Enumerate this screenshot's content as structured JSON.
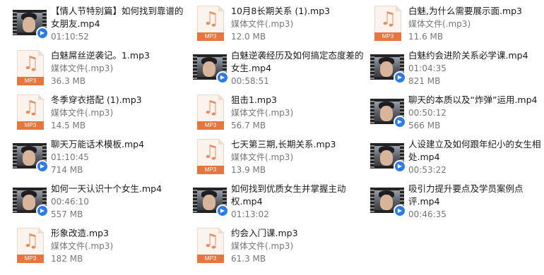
{
  "files": [
    {
      "name": "【情人节特别篇】如何找到靠谱的女朋友.mp4",
      "type_label": "",
      "detail": "01:10:52",
      "kind": "video"
    },
    {
      "name": "10月8长期关系 (1).mp3",
      "type_label": "媒体文件(.mp3)",
      "detail": "12.0 MB",
      "kind": "audio"
    },
    {
      "name": "白魅,为什么需要展示面.mp3",
      "type_label": "媒体文件(.mp3)",
      "detail": "11.6 MB",
      "kind": "audio"
    },
    {
      "name": "白魅屌丝逆袭记。1.mp3",
      "type_label": "媒体文件(.mp3)",
      "detail": "36.3 MB",
      "kind": "audio"
    },
    {
      "name": "白魅逆袭经历及如何搞定态度差的女生.mp4",
      "type_label": "",
      "detail": "00:58:51",
      "kind": "video"
    },
    {
      "name": "白魅约会进阶关系必学课.mp4",
      "type_label": "01:04:35",
      "detail": "821 MB",
      "kind": "video"
    },
    {
      "name": "冬季穿衣搭配 (1).mp3",
      "type_label": "媒体文件(.mp3)",
      "detail": "14.5 MB",
      "kind": "audio"
    },
    {
      "name": "狙击1.mp3",
      "type_label": "媒体文件(.mp3)",
      "detail": "56.7 MB",
      "kind": "audio"
    },
    {
      "name": "聊天的本质以及“炸弹”运用.mp4",
      "type_label": "00:50:12",
      "detail": "566 MB",
      "kind": "video"
    },
    {
      "name": "聊天万能话术模板.mp4",
      "type_label": "01:10:45",
      "detail": "714 MB",
      "kind": "video"
    },
    {
      "name": "七天第三期,长期关系.mp3",
      "type_label": "媒体文件(.mp3)",
      "detail": "13.9 MB",
      "kind": "audio"
    },
    {
      "name": "人设建立及如何跟年纪小的女生相处.mp4",
      "type_label": "",
      "detail": "00:53:22",
      "kind": "video"
    },
    {
      "name": "如何一天认识十个女生.mp4",
      "type_label": "00:46:10",
      "detail": "557 MB",
      "kind": "video"
    },
    {
      "name": "如何找到优质女生并掌握主动权.mp4",
      "type_label": "",
      "detail": "01:13:02",
      "kind": "video"
    },
    {
      "name": "吸引力提升要点及学员案例点评.mp4",
      "type_label": "",
      "detail": "00:46:35",
      "kind": "video"
    },
    {
      "name": "形象改造.mp3",
      "type_label": "媒体文件(.mp3)",
      "detail": "182 MB",
      "kind": "audio"
    },
    {
      "name": "约会入门课.mp3",
      "type_label": "媒体文件(.mp3)",
      "detail": "61.3 MB",
      "kind": "audio"
    }
  ],
  "icons": {
    "audio_icon": "mp3-file-icon",
    "audio_bar_label": "MP3",
    "video_icon": "video-thumbnail-icon"
  },
  "colors": {
    "mp3_bar": "#e7753e",
    "badge": "#2d7be5",
    "meta_text": "#777777"
  }
}
